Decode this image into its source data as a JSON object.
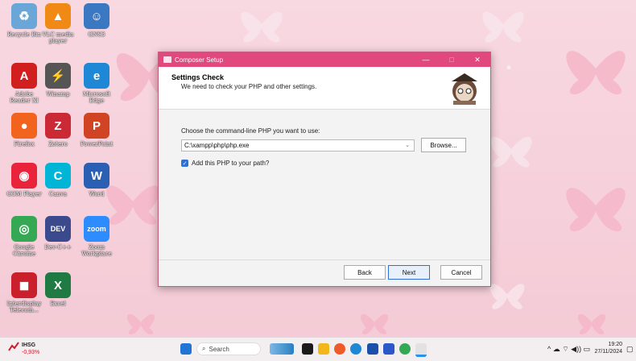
{
  "desktop": {
    "icons": [
      {
        "label": "Recycle Bin",
        "color": "#6aa7d8",
        "glyph": "♻"
      },
      {
        "label": "VLC media player",
        "color": "#f08a14",
        "glyph": "▲"
      },
      {
        "label": "GNS3",
        "color": "#3a78c2",
        "glyph": "☺"
      },
      {
        "label": "Adobe Reader XI",
        "color": "#d11f1f",
        "glyph": "A"
      },
      {
        "label": "Winamp",
        "color": "#555555",
        "glyph": "⚡"
      },
      {
        "label": "Microsoft Edge",
        "color": "#1e88d6",
        "glyph": "e"
      },
      {
        "label": "Firefox",
        "color": "#f2631d",
        "glyph": "●"
      },
      {
        "label": "Zotero",
        "color": "#cc2936",
        "glyph": "Z"
      },
      {
        "label": "PowerPoint",
        "color": "#d04423",
        "glyph": "P"
      },
      {
        "label": "GOM Player",
        "color": "#e8233a",
        "glyph": "◉"
      },
      {
        "label": "Canva",
        "color": "#00b5d6",
        "glyph": "C"
      },
      {
        "label": "Word",
        "color": "#2b5fb4",
        "glyph": "W"
      },
      {
        "label": "Google Chrome",
        "color": "#34a853",
        "glyph": "◎"
      },
      {
        "label": "Dev-C++",
        "color": "#3b4a8c",
        "glyph": "DEV"
      },
      {
        "label": "Zoom Workplace",
        "color": "#2d8cff",
        "glyph": "zoom"
      },
      {
        "label": "Interdisplay Telecom...",
        "color": "#c9202c",
        "glyph": "◼"
      },
      {
        "label": "Excel",
        "color": "#1f7a44",
        "glyph": "X"
      }
    ]
  },
  "dialog": {
    "title": "Composer Setup",
    "minimize": "—",
    "maximize": "□",
    "close": "✕",
    "heading": "Settings Check",
    "subheading": "We need to check your PHP and other settings.",
    "choose_label": "Choose the command-line PHP you want to use:",
    "php_path": "C:\\xampp\\php\\php.exe",
    "browse_label": "Browse...",
    "add_to_path_label": "Add this PHP to your path?",
    "add_to_path_checked": true,
    "back_label": "Back",
    "next_label": "Next",
    "cancel_label": "Cancel"
  },
  "taskbar": {
    "weather_name": "IHSG",
    "weather_change": "-0,93%",
    "search_placeholder": "Search",
    "time": "19:20",
    "date": "27/11/2024"
  },
  "colors": {
    "accent": "#e0487e",
    "wallpaper": "#f6d3dd",
    "checkbox": "#2f6fd6"
  }
}
